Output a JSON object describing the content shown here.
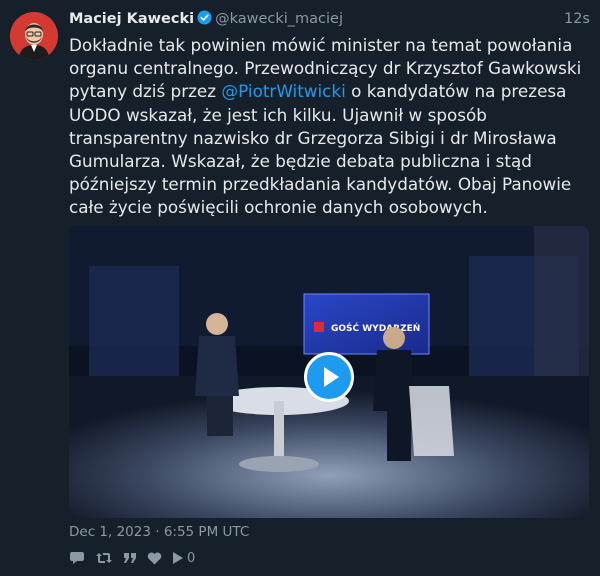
{
  "tweet": {
    "author_name": "Maciej Kawecki",
    "author_handle": "@kawecki_maciej",
    "relative_time": "12s",
    "text_before_mention": "Dokładnie tak powinien mówić minister na temat powołania organu centralnego. Przewodniczący dr Krzysztof Gawkowski pytany dziś przez ",
    "mention": "@PiotrWitwicki",
    "text_after_mention": " o kandydatów na prezesa UODO wskazał, że jest ich kilku. Ujawnił w sposób transparentny nazwisko dr Grzegorza Sibigi i dr Mirosława Gumularza. Wskazał, że będzie debata publiczna i stąd późniejszy termin przedkładania kandydatów. Obaj Panowie całe życie poświęcili ochronie danych osobowych.",
    "date": "Dec 1, 2023 · 6:55 PM UTC",
    "views_count": "0",
    "video_overlay_text": "GOŚĆ WYDARZEŃ"
  },
  "colors": {
    "background": "#15202b",
    "accent": "#1d9bf0",
    "muted": "#8b98a5",
    "text": "#e7e9ea"
  },
  "icons": [
    "verified-badge-icon",
    "reply-icon",
    "retweet-icon",
    "quote-icon",
    "like-icon",
    "views-play-icon",
    "video-play-icon"
  ]
}
